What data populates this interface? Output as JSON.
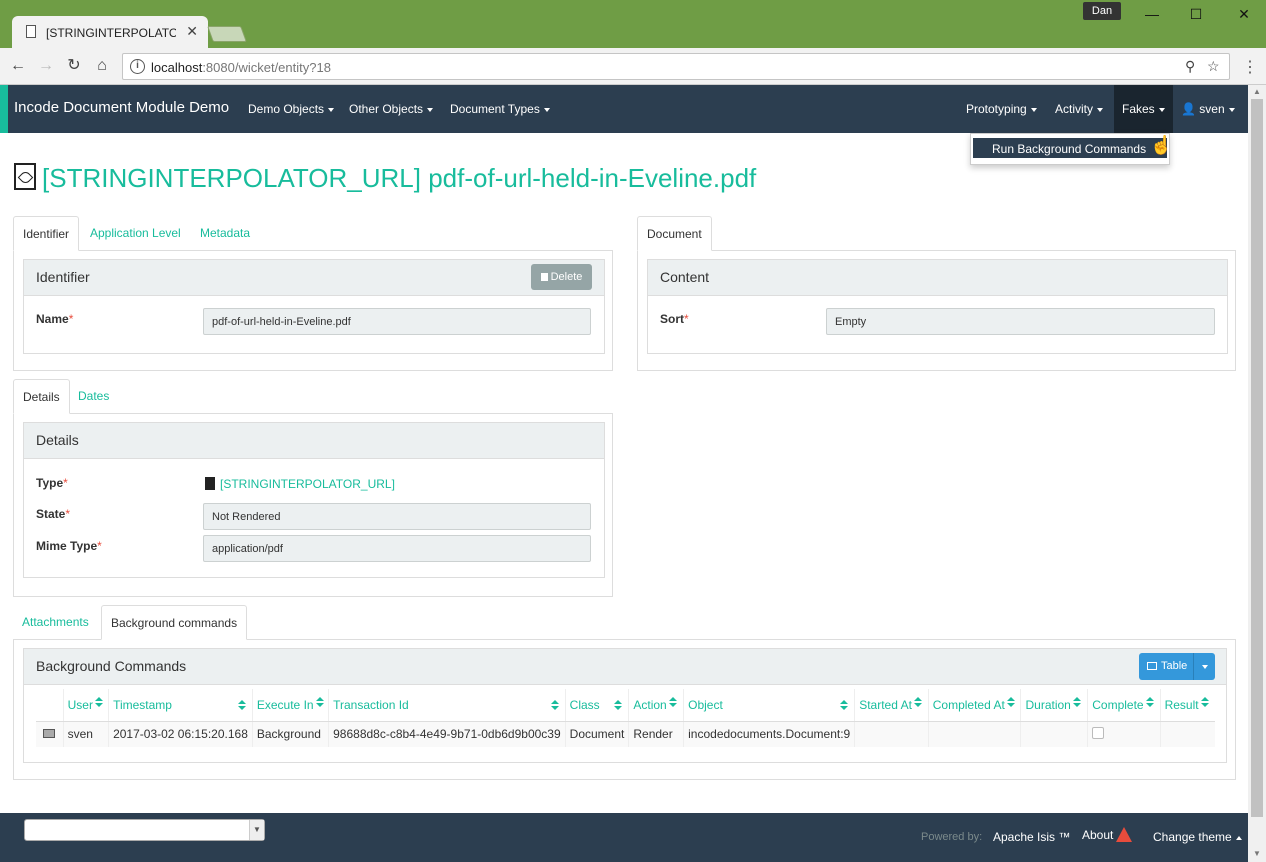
{
  "browser": {
    "tab_title": "[STRINGINTERPOLATOR_",
    "user_chip": "Dan",
    "url_host": "localhost",
    "url_rest": ":8080/wicket/entity?18"
  },
  "navbar": {
    "brand": "Incode Document Module Demo",
    "menus": [
      "Demo Objects",
      "Other Objects",
      "Document Types"
    ],
    "right_menus": [
      "Prototyping",
      "Activity",
      "Fakes"
    ],
    "user": "sven"
  },
  "dropdown": {
    "item": "Run Background Commands"
  },
  "page": {
    "title": "[STRINGINTERPOLATOR_URL] pdf-of-url-held-in-Eveline.pdf"
  },
  "identifier_section": {
    "tabs": [
      "Identifier",
      "Application Level",
      "Metadata"
    ],
    "panel_title": "Identifier",
    "delete_label": "Delete",
    "name_label": "Name",
    "name_value": "pdf-of-url-held-in-Eveline.pdf"
  },
  "document_section": {
    "tabs": [
      "Document"
    ],
    "panel_title": "Content",
    "sort_label": "Sort",
    "sort_value": "Empty"
  },
  "details_section": {
    "tabs": [
      "Details",
      "Dates"
    ],
    "panel_title": "Details",
    "type_label": "Type",
    "type_value": "[STRINGINTERPOLATOR_URL]",
    "state_label": "State",
    "state_value": "Not Rendered",
    "mime_label": "Mime Type",
    "mime_value": "application/pdf"
  },
  "background_section": {
    "tabs": [
      "Attachments",
      "Background commands"
    ],
    "panel_title": "Background Commands",
    "table_button": "Table",
    "columns": [
      "User",
      "Timestamp",
      "Execute In",
      "Transaction Id",
      "Class",
      "Action",
      "Object",
      "Started At",
      "Completed At",
      "Duration",
      "Complete",
      "Result"
    ],
    "rows": [
      {
        "user": "sven",
        "timestamp": "2017-03-02 06:15:20.168",
        "execute_in": "Background",
        "transaction_id": "98688d8c-c8b4-4e49-9b71-0db6d9b00c39",
        "class": "Document",
        "action": "Render",
        "object": "incodedocuments.Document:9",
        "started_at": "",
        "completed_at": "",
        "duration": "",
        "result": ""
      }
    ]
  },
  "footer": {
    "powered_by": "Powered by:",
    "apache_isis": "Apache Isis ™",
    "about": "About",
    "change_theme": "Change theme"
  }
}
